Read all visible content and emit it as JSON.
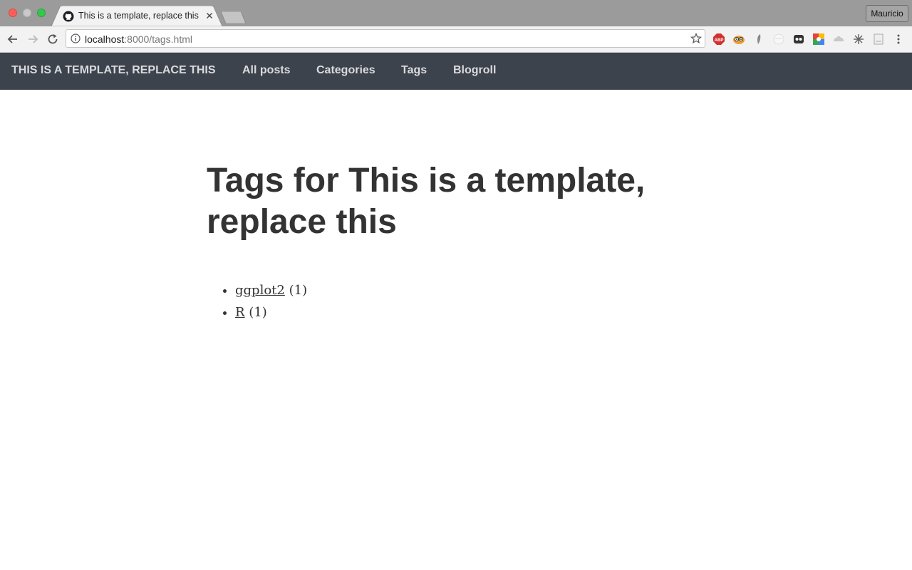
{
  "browser": {
    "tab_title": "This is a template, replace this",
    "profile_name": "Mauricio",
    "url_host": "localhost",
    "url_rest": ":8000/tags.html",
    "extensions": [
      "adblock-icon",
      "owl-icon",
      "bird-icon",
      "blank-circle-icon",
      "ghost-icon",
      "google-icon",
      "drive-icon",
      "sparkle-icon",
      "page-icon"
    ]
  },
  "site_nav": {
    "brand": "THIS IS A TEMPLATE, REPLACE THIS",
    "links": [
      "All posts",
      "Categories",
      "Tags",
      "Blogroll"
    ]
  },
  "main": {
    "title": "Tags for This is a template, replace this",
    "tags": [
      {
        "name": "ggplot2",
        "count": "(1)"
      },
      {
        "name": "R",
        "count": "(1)"
      }
    ]
  }
}
